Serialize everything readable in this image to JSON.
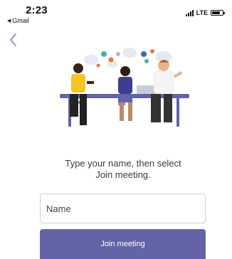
{
  "status_bar": {
    "time": "2:23",
    "back_app": "Gmail",
    "back_app_arrow": "◀",
    "network": "LTE",
    "icons": [
      "signal-icon",
      "battery-icon"
    ]
  },
  "nav": {
    "back_icon": "chevron-left-icon"
  },
  "illustration": {
    "icon": "meeting-illustration"
  },
  "join": {
    "prompt_line1": "Type your name, then select",
    "prompt_line2": "Join meeting.",
    "name_placeholder": "Name",
    "button_label": "Join meeting"
  },
  "colors": {
    "accent": "#6264a7",
    "back_chevron": "#8a8cc9"
  }
}
